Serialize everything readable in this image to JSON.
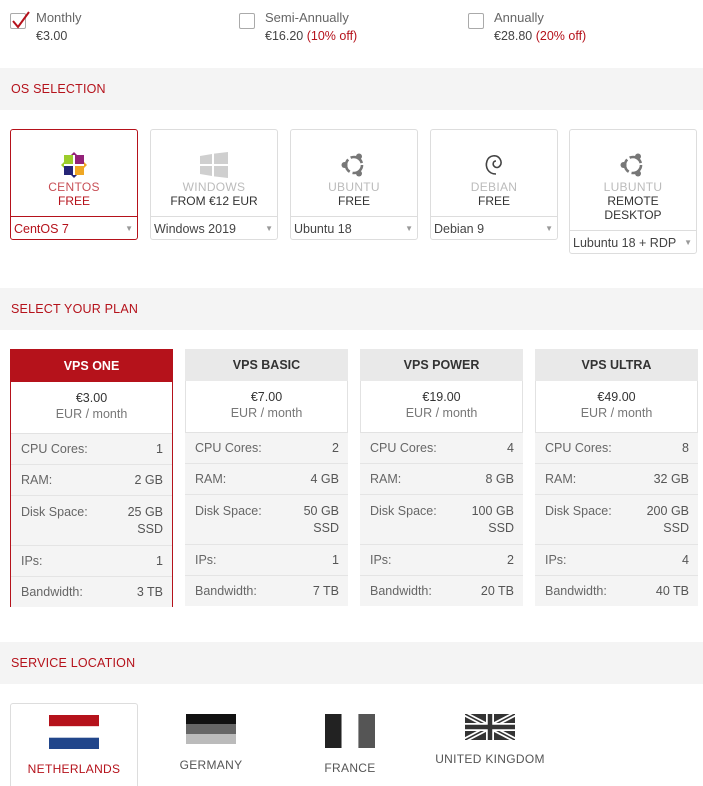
{
  "billing": [
    {
      "label": "Monthly",
      "price": "€3.00",
      "discount": "",
      "checked": true
    },
    {
      "label": "Semi-Annually",
      "price": "€16.20",
      "discount": "(10% off)",
      "checked": false
    },
    {
      "label": "Annually",
      "price": "€28.80",
      "discount": "(20% off)",
      "checked": false
    }
  ],
  "sections": {
    "os": "OS SELECTION",
    "plan": "SELECT YOUR PLAN",
    "location": "SERVICE LOCATION"
  },
  "os": [
    {
      "name": "CENTOS",
      "price": "FREE",
      "price2": "",
      "selected_version": "CentOS 7",
      "icon": "centos-icon"
    },
    {
      "name": "WINDOWS",
      "price": "FROM €12 EUR",
      "price2": "",
      "selected_version": "Windows 2019",
      "icon": "windows-icon"
    },
    {
      "name": "UBUNTU",
      "price": "FREE",
      "price2": "",
      "selected_version": "Ubuntu 18",
      "icon": "ubuntu-icon"
    },
    {
      "name": "DEBIAN",
      "price": "FREE",
      "price2": "",
      "selected_version": "Debian 9",
      "icon": "debian-icon"
    },
    {
      "name": "LUBUNTU",
      "price": "REMOTE",
      "price2": "DESKTOP",
      "selected_version": "Lubuntu 18 + RDP",
      "icon": "ubuntu-icon"
    }
  ],
  "plans": [
    {
      "name": "VPS ONE",
      "price": "€3.00",
      "period": "EUR / month",
      "rows": [
        [
          "CPU Cores:",
          "1"
        ],
        [
          "RAM:",
          "2 GB"
        ],
        [
          "Disk Space:",
          "25 GB SSD"
        ],
        [
          "IPs:",
          "1"
        ],
        [
          "Bandwidth:",
          "3 TB"
        ]
      ]
    },
    {
      "name": "VPS BASIC",
      "price": "€7.00",
      "period": "EUR / month",
      "rows": [
        [
          "CPU Cores:",
          "2"
        ],
        [
          "RAM:",
          "4 GB"
        ],
        [
          "Disk Space:",
          "50 GB SSD"
        ],
        [
          "IPs:",
          "1"
        ],
        [
          "Bandwidth:",
          "7 TB"
        ]
      ]
    },
    {
      "name": "VPS POWER",
      "price": "€19.00",
      "period": "EUR / month",
      "rows": [
        [
          "CPU Cores:",
          "4"
        ],
        [
          "RAM:",
          "8 GB"
        ],
        [
          "Disk Space:",
          "100 GB SSD"
        ],
        [
          "IPs:",
          "2"
        ],
        [
          "Bandwidth:",
          "20 TB"
        ]
      ]
    },
    {
      "name": "VPS ULTRA",
      "price": "€49.00",
      "period": "EUR / month",
      "rows": [
        [
          "CPU Cores:",
          "8"
        ],
        [
          "RAM:",
          "32 GB"
        ],
        [
          "Disk Space:",
          "200 GB SSD"
        ],
        [
          "IPs:",
          "4"
        ],
        [
          "Bandwidth:",
          "40 TB"
        ]
      ]
    }
  ],
  "locations": [
    {
      "name": "NETHERLANDS",
      "flag": "netherlands-flag-icon"
    },
    {
      "name": "GERMANY",
      "flag": "germany-flag-icon"
    },
    {
      "name": "FRANCE",
      "flag": "france-flag-icon"
    },
    {
      "name": "UNITED KINGDOM",
      "flag": "uk-flag-icon"
    }
  ],
  "colors": {
    "accent": "#b5121b",
    "section_bg": "#f4f4f4"
  }
}
